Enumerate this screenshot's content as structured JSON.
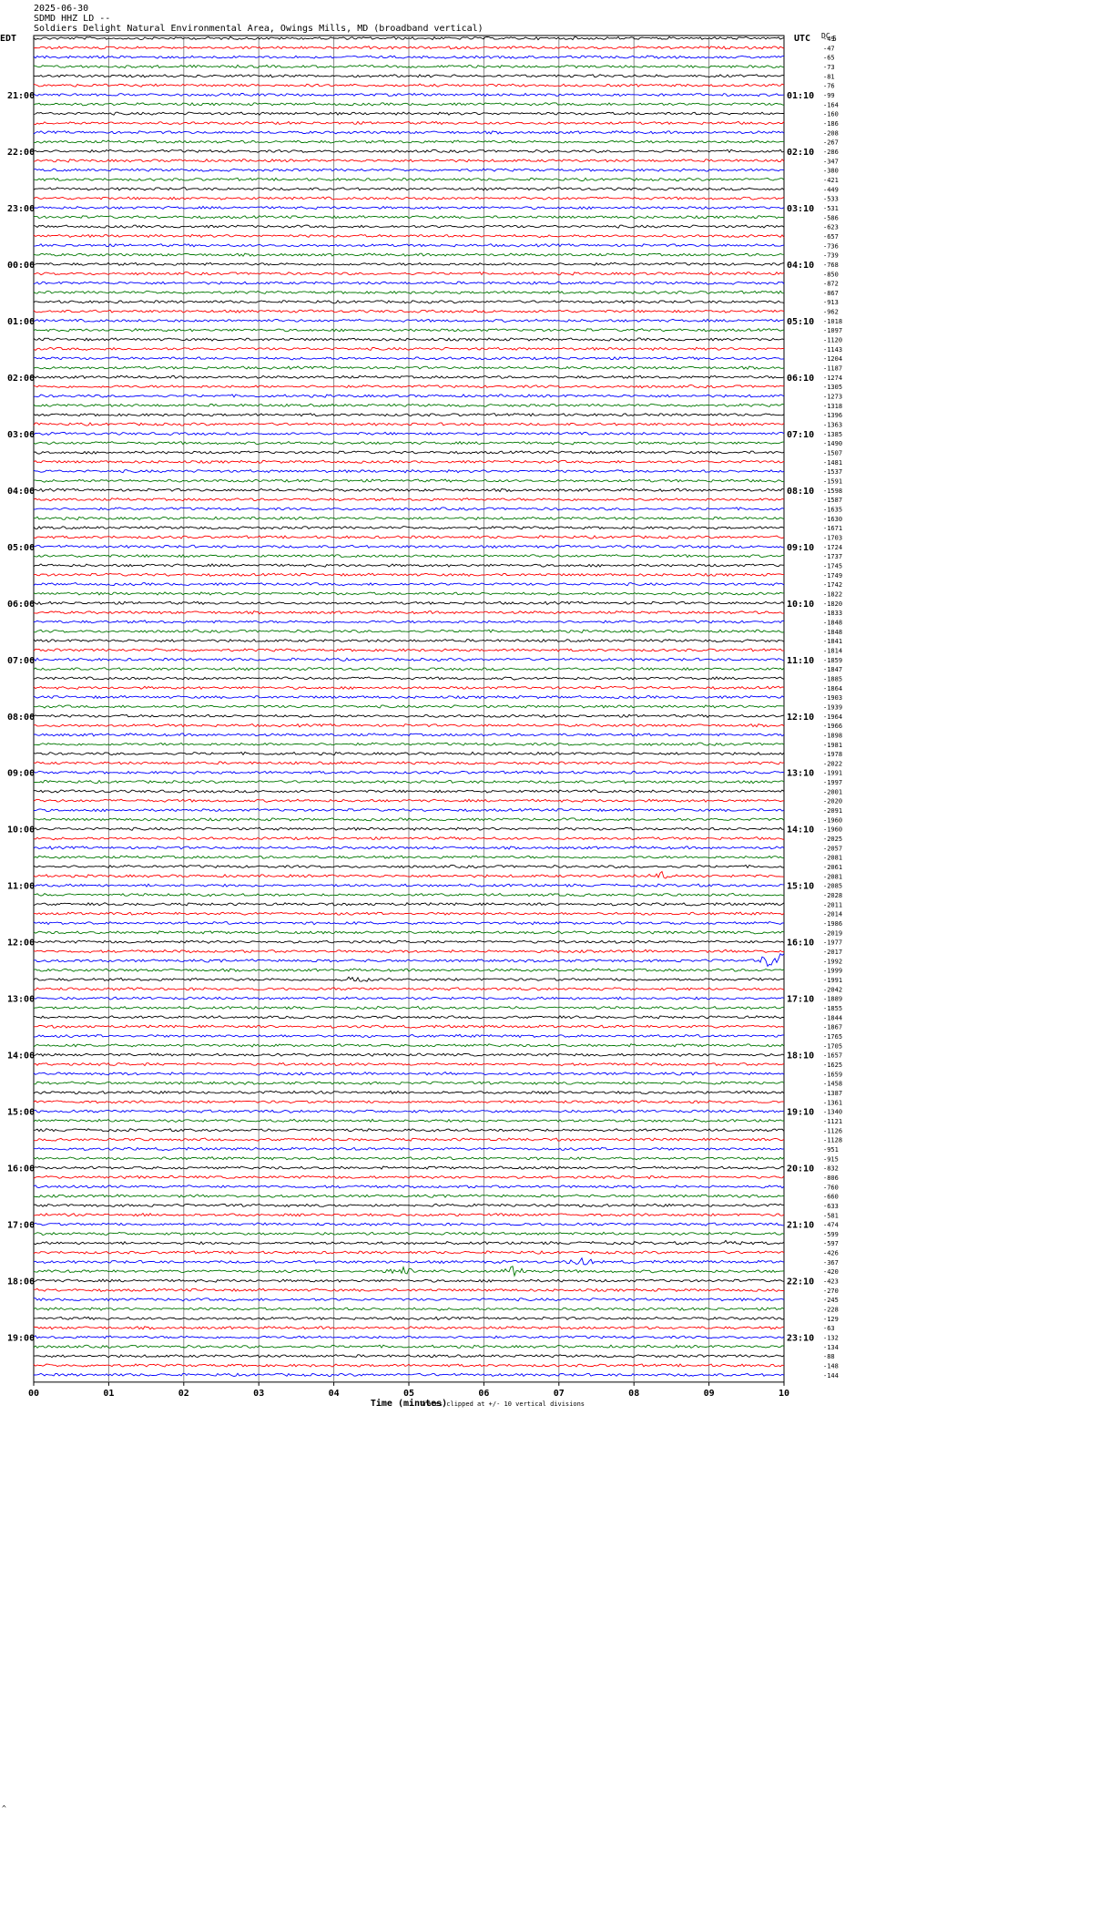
{
  "header": {
    "date": "2025-06-30",
    "station": "SDMD HHZ LD --",
    "site": "Soldiers Delight Natural Environmental Area, Owings Mills, MD (broadband vertical)"
  },
  "left_tz": "EDT",
  "right_tz": "UTC",
  "dc_label": "DC",
  "scale_label": "5",
  "footer_mark": "^",
  "chart_data": {
    "type": "line",
    "title": "SDMD HHZ LD -- helicorder 2025-06-30",
    "xlabel": "Time (minutes)",
    "x_ticks": [
      "00",
      "01",
      "02",
      "03",
      "04",
      "05",
      "06",
      "07",
      "08",
      "09",
      "10"
    ],
    "xlim": [
      0,
      10
    ],
    "clip_note": "Traces clipped at +/- 10 vertical divisions",
    "left_hour_labels": [
      "21:00",
      "22:00",
      "23:00",
      "00:00",
      "01:00",
      "02:00",
      "03:00",
      "04:00",
      "05:00",
      "06:00",
      "07:00",
      "08:00",
      "09:00",
      "10:00",
      "11:00",
      "12:00",
      "13:00",
      "14:00",
      "15:00",
      "16:00",
      "17:00",
      "18:00",
      "19:00"
    ],
    "right_hour_labels": [
      "01:10",
      "02:10",
      "03:10",
      "04:10",
      "05:10",
      "06:10",
      "07:10",
      "08:10",
      "09:10",
      "10:10",
      "11:10",
      "12:10",
      "13:10",
      "14:10",
      "15:10",
      "16:10",
      "17:10",
      "18:10",
      "19:10",
      "20:10",
      "21:10",
      "22:10",
      "23:10"
    ],
    "trace_colors": [
      "#000000",
      "#ff0000",
      "#0000ff",
      "#007700"
    ],
    "dc_offsets": [
      -49,
      -47,
      -65,
      -73,
      -81,
      -76,
      -99,
      -164,
      -160,
      -186,
      -208,
      -267,
      -286,
      -347,
      -380,
      -421,
      -449,
      -533,
      -531,
      -586,
      -623,
      -657,
      -736,
      -739,
      -768,
      -850,
      -872,
      -867,
      -913,
      -962,
      -1018,
      -1097,
      -1120,
      -1143,
      -1204,
      -1187,
      -1274,
      -1305,
      -1273,
      -1318,
      -1396,
      -1363,
      -1385,
      -1490,
      -1507,
      -1481,
      -1537,
      -1591,
      -1598,
      -1587,
      -1635,
      -1630,
      -1671,
      -1703,
      -1724,
      -1737,
      -1745,
      -1749,
      -1742,
      -1822,
      -1820,
      -1833,
      -1848,
      -1848,
      -1841,
      -1814,
      -1859,
      -1847,
      -1885,
      -1864,
      -1903,
      -1939,
      -1964,
      -1966,
      -1898,
      -1981,
      -1978,
      -2022,
      -1991,
      -1997,
      -2001,
      -2020,
      -2091,
      -1960,
      -1960,
      -2025,
      -2057,
      -2081,
      -2061,
      -2081,
      -2085,
      -2028,
      -2011,
      -2014,
      -1986,
      -2019,
      -1977,
      -2017,
      -1992,
      -1999,
      -1991,
      -2042,
      -1889,
      -1855,
      -1844,
      -1867,
      -1765,
      -1705,
      -1657,
      -1625,
      -1659,
      -1458,
      -1387,
      -1361,
      -1340,
      -1121,
      -1126,
      -1128,
      -951,
      -915,
      -832,
      -806,
      -760,
      -660,
      -633,
      -581,
      -474,
      -599,
      -597,
      -426,
      -367,
      -420,
      -423,
      -270,
      -245,
      -228,
      -129,
      -63,
      -132,
      -134,
      -88,
      -148,
      -144
    ],
    "events": [
      {
        "row": 89,
        "minute": 8.4,
        "amplitude": 5
      },
      {
        "row": 98,
        "minute": 9.9,
        "amplitude": 14
      },
      {
        "row": 100,
        "minute": 4.3,
        "amplitude": 4
      },
      {
        "row": 131,
        "minute": 4.9,
        "amplitude": 5
      },
      {
        "row": 131,
        "minute": 6.4,
        "amplitude": 6
      },
      {
        "row": 130,
        "minute": 7.3,
        "amplitude": 5
      },
      {
        "row": 128,
        "minute": 9.3,
        "amplitude": 3
      }
    ]
  }
}
